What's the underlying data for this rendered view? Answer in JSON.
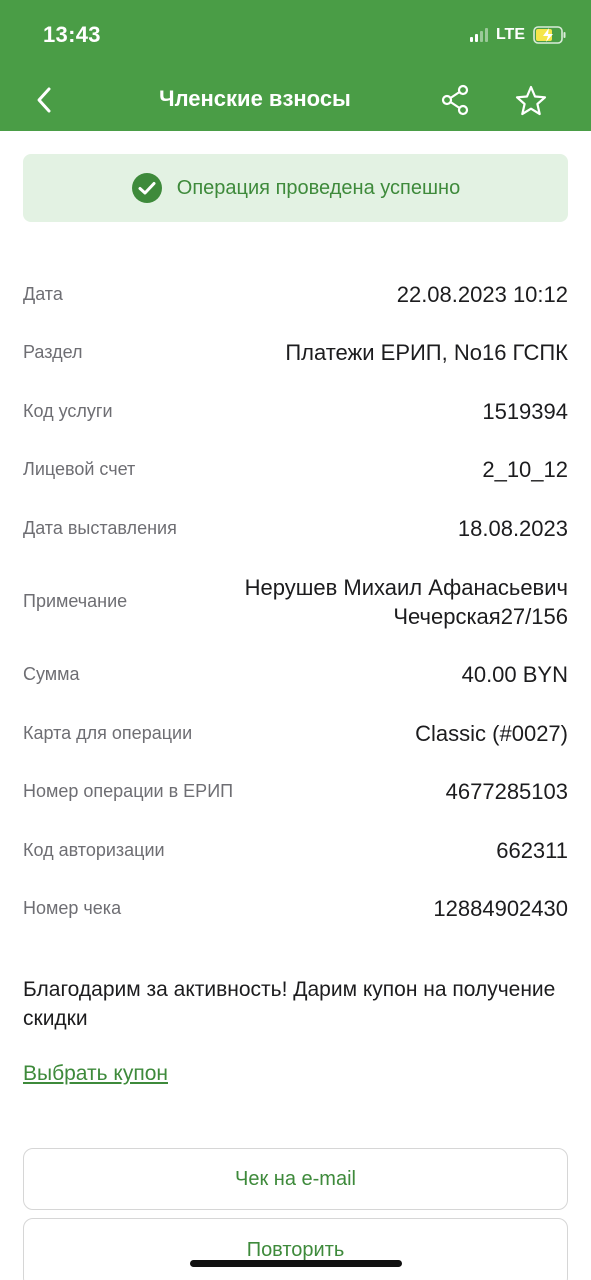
{
  "status_bar": {
    "time": "13:43",
    "network": "LTE"
  },
  "nav": {
    "title": "Членские взносы",
    "icons": [
      "chevron-left-icon",
      "share-icon",
      "star-icon"
    ]
  },
  "banner": {
    "text": "Операция проведена успешно",
    "icon": "check-circle-icon"
  },
  "details": [
    {
      "label": "Дата",
      "value": "22.08.2023 10:12"
    },
    {
      "label": "Раздел",
      "value": "Платежи ЕРИП, No16 ГСПК"
    },
    {
      "label": "Код услуги",
      "value": "1519394"
    },
    {
      "label": "Лицевой счет",
      "value": "2_10_12"
    },
    {
      "label": "Дата выставления",
      "value": "18.08.2023"
    },
    {
      "label": "Примечание",
      "value_line1": "Нерушев Михаил Афанасьевич",
      "value_line2": "Чечерская27/156"
    },
    {
      "label": "Сумма",
      "value": "40.00 BYN"
    },
    {
      "label": "Карта для операции",
      "value": "Classic (#0027)"
    },
    {
      "label": "Номер операции в ЕРИП",
      "value": "4677285103"
    },
    {
      "label": "Код авторизации",
      "value": "662311"
    },
    {
      "label": "Номер чека",
      "value": "12884902430"
    }
  ],
  "promo": {
    "text": "Благодарим за активность! Дарим купон на получение скидки",
    "link": "Выбрать купон"
  },
  "buttons": {
    "email": "Чек на e-mail",
    "repeat": "Повторить"
  },
  "colors": {
    "brand_green": "#4a9d46",
    "success_bg": "#e3f2e3",
    "success_text": "#3e8a3b"
  }
}
